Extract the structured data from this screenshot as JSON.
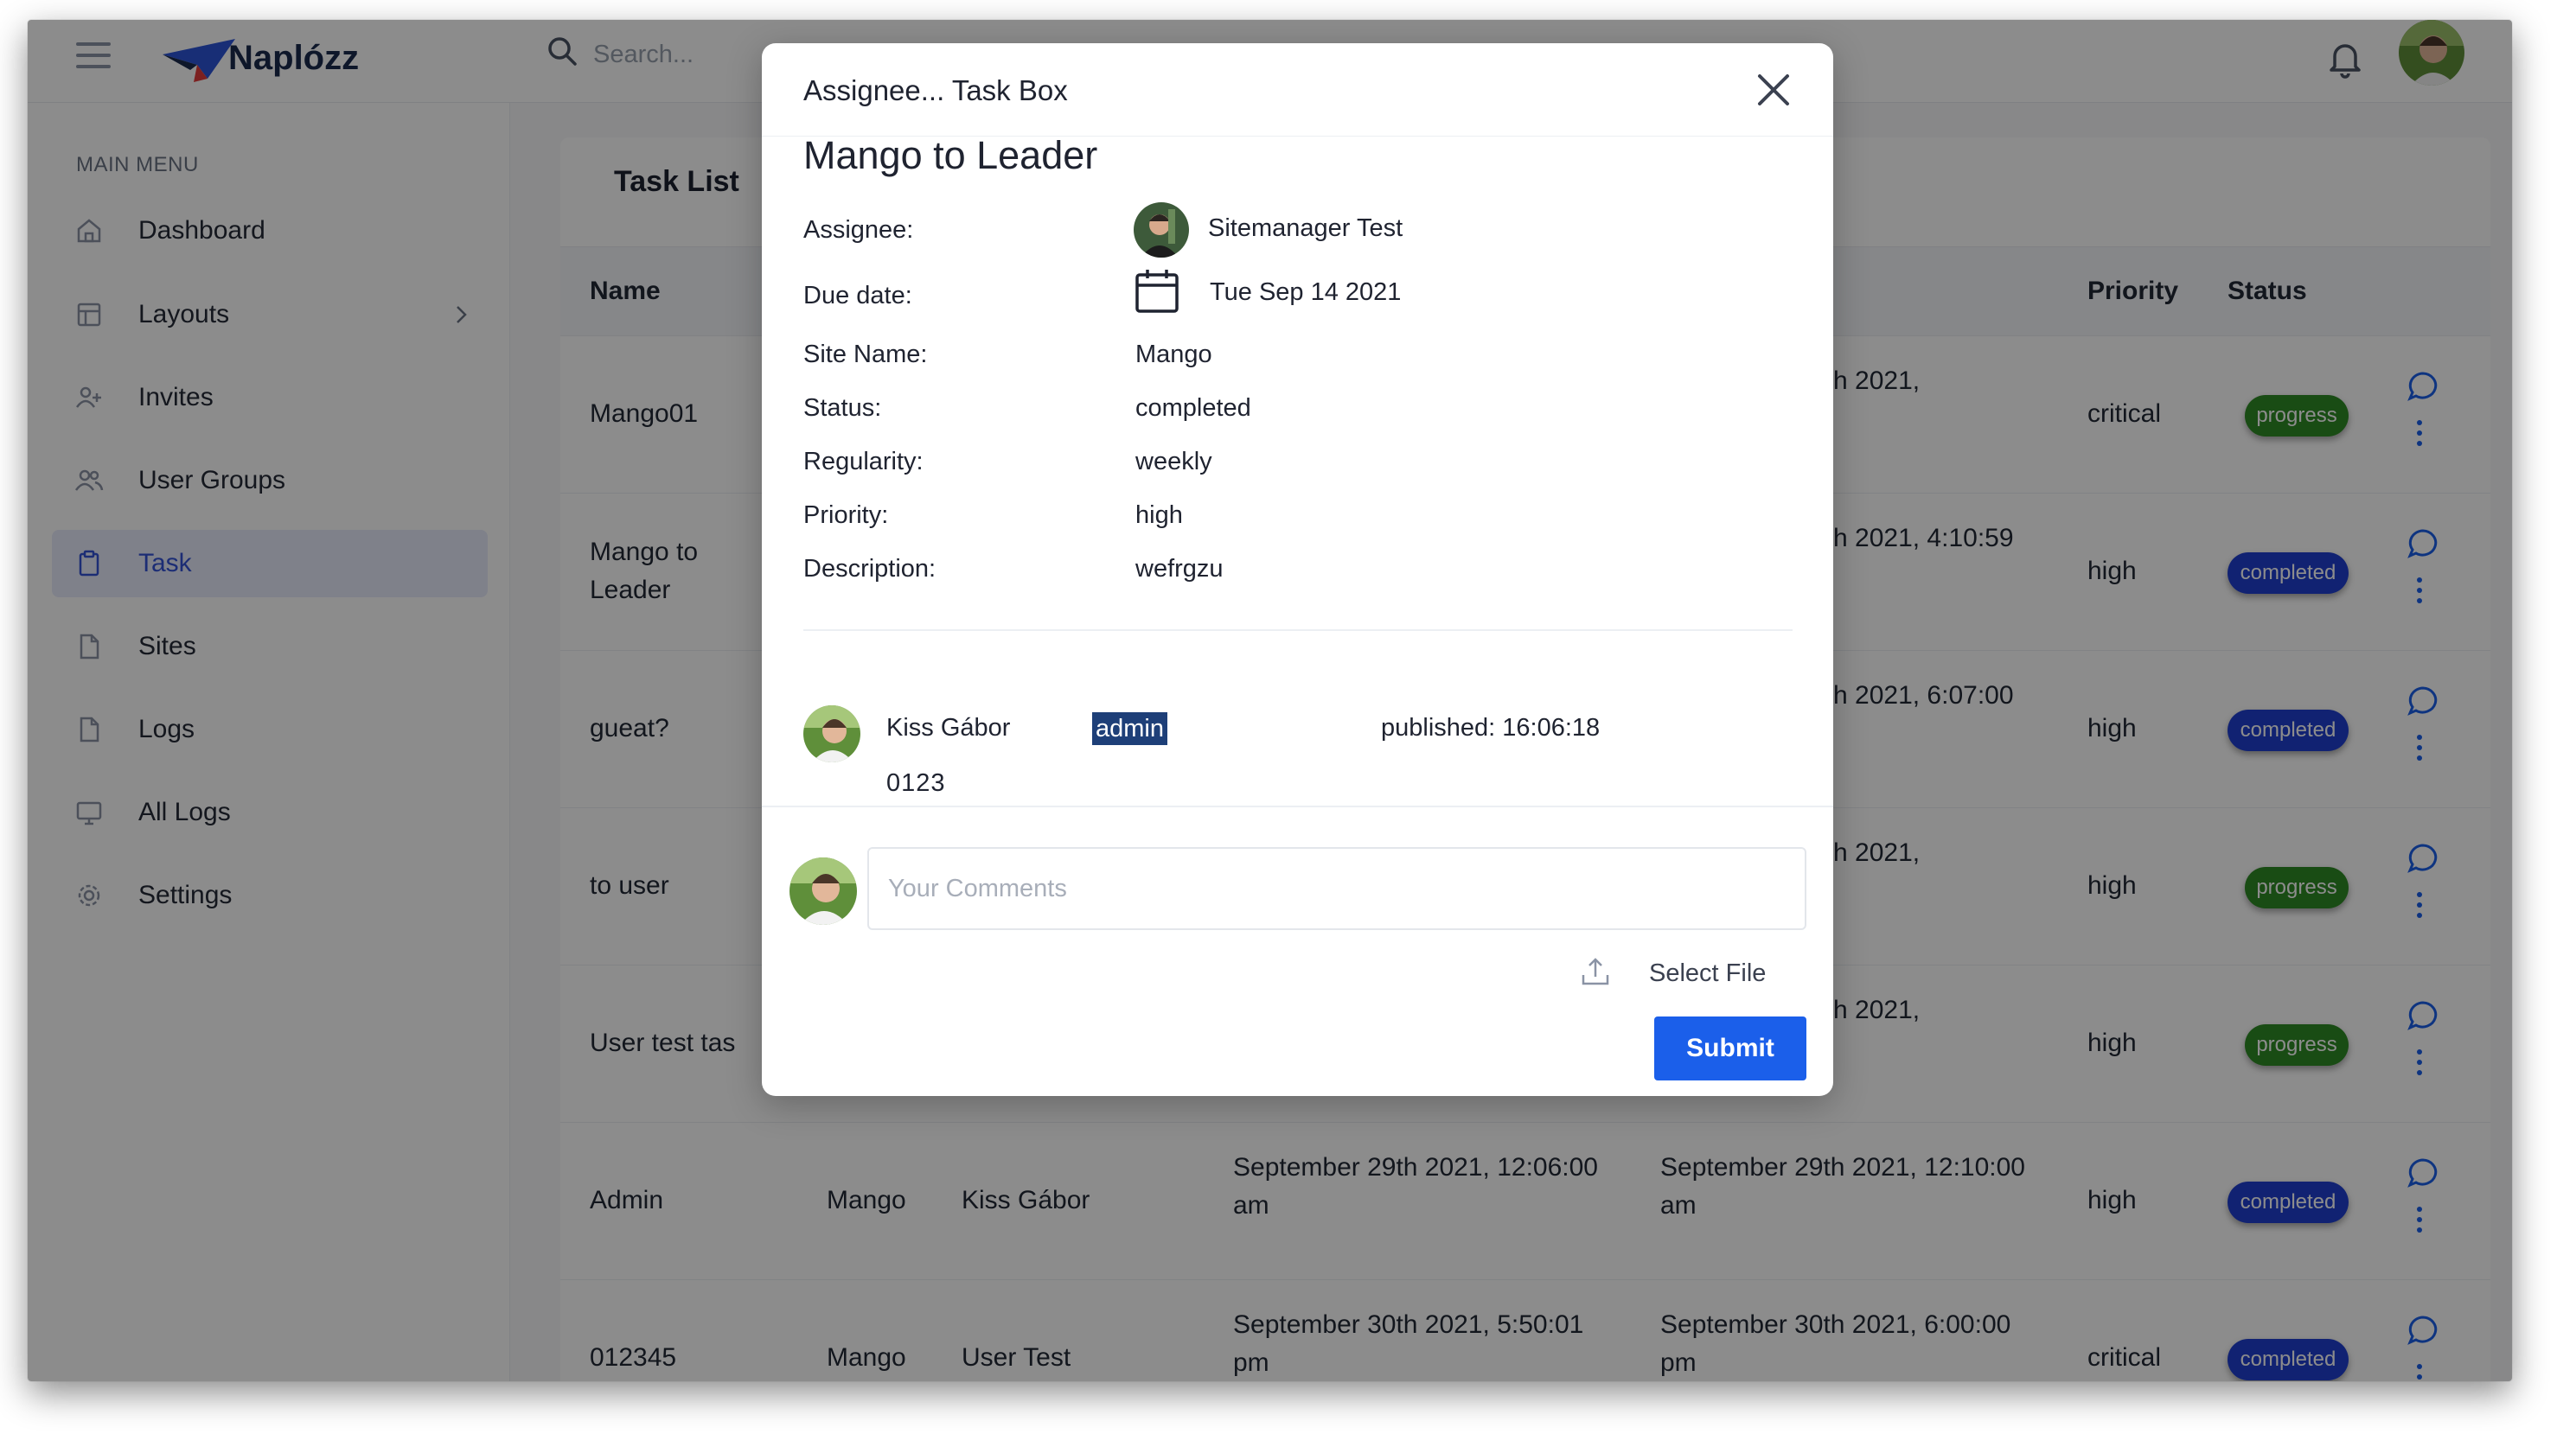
{
  "app": {
    "name": "Naplózz"
  },
  "search": {
    "placeholder": "Search..."
  },
  "sidebar": {
    "menu_title": "MAIN MENU",
    "items": [
      {
        "label": "Dashboard",
        "icon": "home-icon"
      },
      {
        "label": "Layouts",
        "icon": "layout-icon"
      },
      {
        "label": "Invites",
        "icon": "user-plus-icon"
      },
      {
        "label": "User Groups",
        "icon": "users-icon"
      },
      {
        "label": "Task",
        "icon": "clipboard-icon",
        "active": true
      },
      {
        "label": "Sites",
        "icon": "file-icon"
      },
      {
        "label": "Logs",
        "icon": "file-icon"
      },
      {
        "label": "All Logs",
        "icon": "monitor-icon"
      },
      {
        "label": "Settings",
        "icon": "gear-icon"
      }
    ]
  },
  "main": {
    "title": "Task List",
    "columns": {
      "name": "Name",
      "priority": "Priority",
      "status": "Status"
    },
    "rows": [
      {
        "name": "Mango01",
        "site": "",
        "assignee": "",
        "start": "",
        "end": "h 2021,",
        "priority": "critical",
        "status": "progress"
      },
      {
        "name": "Mango to Leader",
        "site": "",
        "assignee": "",
        "start": "",
        "end": "h 2021, 4:10:59",
        "priority": "high",
        "status": "completed"
      },
      {
        "name": "gueat?",
        "site": "",
        "assignee": "",
        "start": "",
        "end": "h 2021, 6:07:00",
        "priority": "high",
        "status": "completed"
      },
      {
        "name": "to user",
        "site": "",
        "assignee": "",
        "start": "",
        "end": "h 2021,",
        "priority": "high",
        "status": "progress"
      },
      {
        "name": "User test tas",
        "site": "",
        "assignee": "",
        "start": "",
        "end": "h 2021,",
        "priority": "high",
        "status": "progress"
      },
      {
        "name": "Admin",
        "site": "Mango",
        "assignee": "Kiss Gábor",
        "start": "September 29th 2021, 12:06:00 am",
        "end": "September 29th 2021, 12:10:00 am",
        "priority": "high",
        "status": "completed"
      },
      {
        "name": "012345",
        "site": "Mango",
        "assignee": "User Test",
        "start": "September 30th 2021, 5:50:01 pm",
        "end": "September 30th 2021, 6:00:00 pm",
        "priority": "critical",
        "status": "completed"
      }
    ]
  },
  "modal": {
    "title": "Assignee... Task Box",
    "task_name": "Mango to Leader",
    "labels": {
      "assignee": "Assignee:",
      "due_date": "Due date:",
      "site_name": "Site Name:",
      "status": "Status:",
      "regularity": "Regularity:",
      "priority": "Priority:",
      "description": "Description:"
    },
    "values": {
      "assignee": "Sitemanager Test",
      "due_date": "Tue Sep 14 2021",
      "site_name": "Mango",
      "status": "completed",
      "regularity": "weekly",
      "priority": "high",
      "description": "wefrgzu"
    },
    "comment": {
      "author": "Kiss Gábor",
      "role": "admin",
      "published": "published: 16:06:18",
      "text": "0123"
    },
    "comment_placeholder": "Your Comments",
    "select_file": "Select File",
    "submit": "Submit"
  },
  "colors": {
    "accent": "#1b5fea",
    "progress": "#2f8a26",
    "completed": "#1f3fd0",
    "active_menu_bg": "#e8ebfb"
  }
}
